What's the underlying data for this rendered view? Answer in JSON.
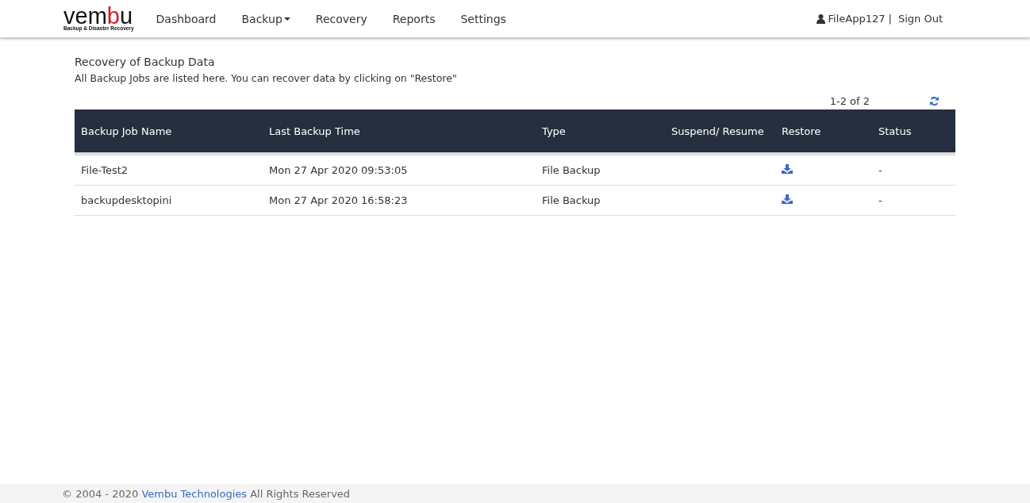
{
  "logo": {
    "parts": [
      {
        "text": "vem",
        "color": "#111111"
      },
      {
        "text": "b",
        "color": "#d71920"
      },
      {
        "text": "u",
        "color": "#111111"
      }
    ],
    "tagline": "Backup & Disaster Recovery"
  },
  "nav": [
    {
      "label": "Dashboard",
      "dropdown": false
    },
    {
      "label": "Backup",
      "dropdown": true
    },
    {
      "label": "Recovery",
      "dropdown": false
    },
    {
      "label": "Reports",
      "dropdown": false
    },
    {
      "label": "Settings",
      "dropdown": false
    }
  ],
  "user": {
    "name": "FileApp127",
    "separator": "|",
    "sign_out": "Sign Out"
  },
  "page": {
    "title": "Recovery of Backup Data",
    "description": "All Backup Jobs are listed here. You can recover data by clicking on \"Restore\""
  },
  "pagination": "1-2 of 2",
  "table": {
    "columns": [
      "Backup Job Name",
      "Last Backup Time",
      "Type",
      "Suspend/ Resume",
      "Restore",
      "Status"
    ],
    "rows": [
      {
        "name": "File-Test2",
        "last_backup": "Mon 27 Apr 2020 09:53:05",
        "type": "File Backup",
        "status": "-"
      },
      {
        "name": "backupdesktopini",
        "last_backup": "Mon 27 Apr 2020 16:58:23",
        "type": "File Backup",
        "status": "-"
      }
    ]
  },
  "footer": {
    "before": "© 2004 - 2020",
    "link": "Vembu Technologies",
    "after": "All Rights Reserved"
  }
}
